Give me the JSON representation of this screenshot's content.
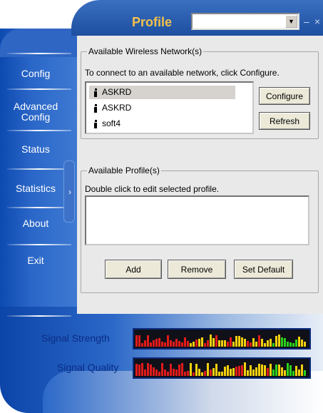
{
  "header": {
    "title": "Profile",
    "profile_value": "",
    "minimize_symbol": "–",
    "close_symbol": "×"
  },
  "nav": {
    "items": [
      {
        "label": "Config"
      },
      {
        "label": "Advanced\nConfig"
      },
      {
        "label": "Status"
      },
      {
        "label": "Statistics"
      },
      {
        "label": "About"
      },
      {
        "label": "Exit"
      }
    ]
  },
  "wireless": {
    "legend": "Available Wireless Network(s)",
    "instruction": "To connect to an available network, click Configure.",
    "networks": [
      "ASKRD",
      "ASKRD",
      "soft4"
    ],
    "configure_label": "Configure",
    "refresh_label": "Refresh"
  },
  "profiles": {
    "legend": "Available Profile(s)",
    "instruction": "Double click to edit selected profile.",
    "items": [],
    "add_label": "Add",
    "remove_label": "Remove",
    "set_default_label": "Set Default"
  },
  "signal": {
    "strength_label": "Signal Strength",
    "quality_label": "Signal Quality",
    "strength_level": 0.45,
    "quality_level": 0.55,
    "colors": {
      "low": "#e21b1b",
      "mid": "#f5d10e",
      "high": "#2bd11c"
    }
  }
}
